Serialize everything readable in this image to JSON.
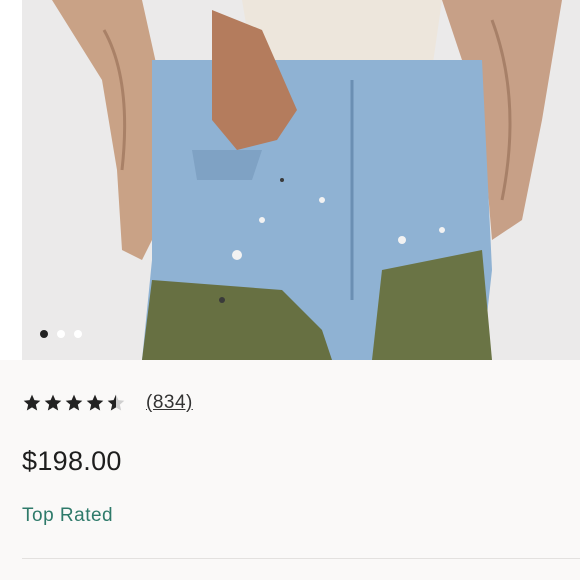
{
  "gallery": {
    "image_alt": "Woman wearing painted light-wash jeans with olive green patch panels and a quilted pink jacket",
    "dots": [
      {
        "active": true
      },
      {
        "active": false
      },
      {
        "active": false
      }
    ]
  },
  "rating": {
    "value": 4.5,
    "max": 5,
    "count_label": "(834)"
  },
  "price": "$198.00",
  "badge": "Top Rated",
  "colors": {
    "badge": "#2e7a6a",
    "star": "#222222",
    "price": "#1e1e1e"
  }
}
